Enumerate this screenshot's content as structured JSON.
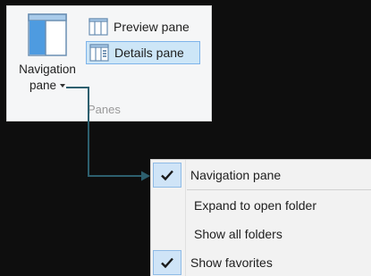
{
  "ribbon": {
    "navigation_pane": {
      "label_line1": "Navigation",
      "label_line2": "pane",
      "icon": "navigation-pane-icon"
    },
    "preview_pane": {
      "label": "Preview pane",
      "icon": "preview-pane-icon"
    },
    "details_pane": {
      "label": "Details pane",
      "icon": "details-pane-icon",
      "selected": true
    },
    "group_label": "Panes"
  },
  "menu": {
    "items": [
      {
        "label": "Navigation pane",
        "checked": true
      },
      {
        "label": "Expand to open folder",
        "checked": false
      },
      {
        "label": "Show all folders",
        "checked": false
      },
      {
        "label": "Show favorites",
        "checked": true
      }
    ]
  },
  "colors": {
    "background": "#0e0e0e",
    "selection": "#cde6f7",
    "selection_border": "#7eb4ea",
    "connector": "#2d5f6e"
  }
}
